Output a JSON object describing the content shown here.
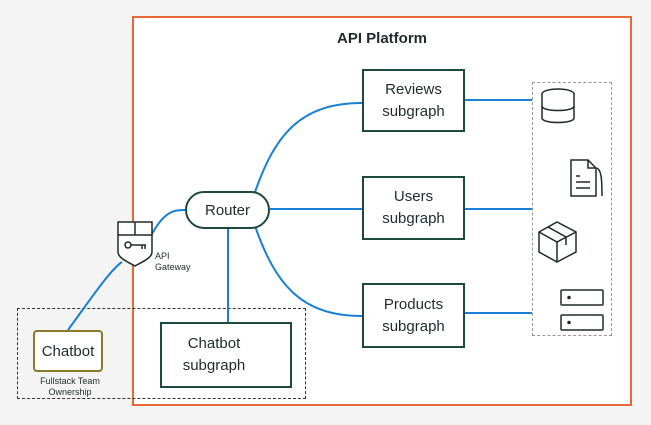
{
  "platform": {
    "title": "API Platform"
  },
  "router": {
    "label": "Router"
  },
  "subgraphs": {
    "reviews": {
      "line1": "Reviews",
      "line2": "subgraph"
    },
    "users": {
      "line1": "Users",
      "line2": "subgraph"
    },
    "products": {
      "line1": "Products",
      "line2": "subgraph"
    },
    "chatbot": {
      "line1": "Chatbot",
      "line2": "subgraph"
    }
  },
  "gateway": {
    "line1": "API",
    "line2": "Gateway"
  },
  "client": {
    "label": "Chatbot"
  },
  "ownership": {
    "line1": "Fullstack Team",
    "line2": "Ownership"
  },
  "icons": [
    "shield-key-icon",
    "database-icon",
    "document-icon",
    "box-icon",
    "server-icon",
    "ai-head-icon"
  ],
  "colors": {
    "connector": "#1a7fd6",
    "platform_border": "#e8673a",
    "node_border": "#1e4a3a",
    "client_border": "#8a7a2b"
  }
}
